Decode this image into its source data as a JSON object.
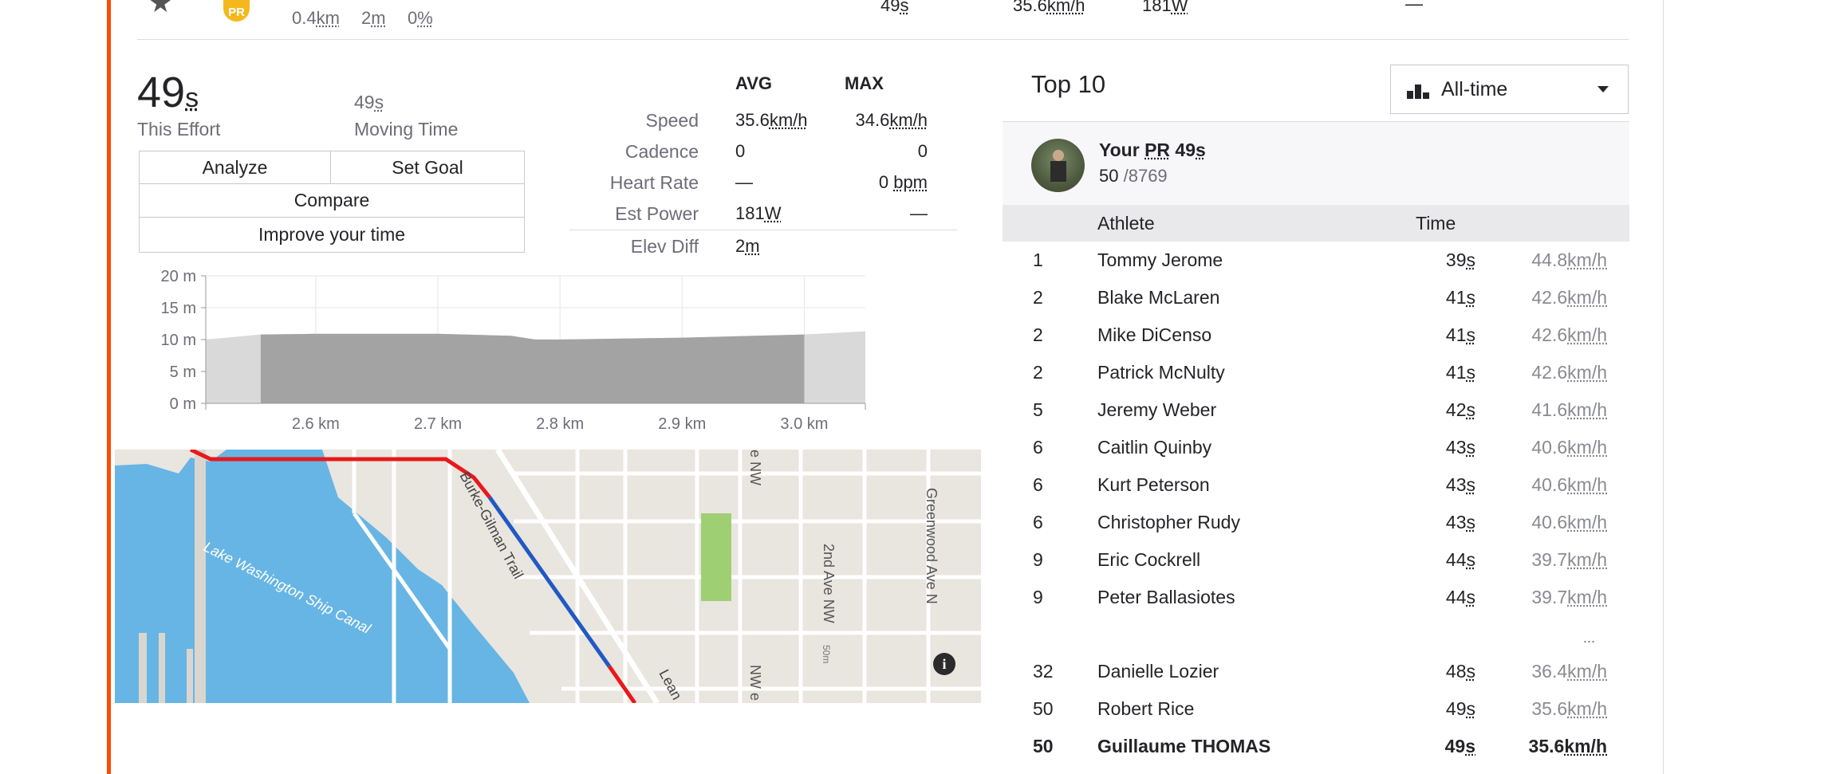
{
  "top_row": {
    "pr_badge": "PR",
    "distance": "0.4",
    "distance_unit": "km",
    "elev": "2",
    "elev_unit": "m",
    "grade": "0",
    "grade_unit": "%",
    "time": "49",
    "time_unit": "s",
    "speed": "35.6",
    "speed_unit": "km/h",
    "power": "181",
    "power_unit": "W",
    "hr": "—"
  },
  "effort": {
    "time": "49",
    "time_unit": "s",
    "label": "This Effort",
    "moving_time": "49",
    "moving_time_unit": "s",
    "moving_label": "Moving Time"
  },
  "buttons": {
    "analyze": "Analyze",
    "set_goal": "Set Goal",
    "compare": "Compare",
    "improve": "Improve your time"
  },
  "stats": {
    "avg_header": "AVG",
    "max_header": "MAX",
    "rows": [
      {
        "label": "Speed",
        "avg": "35.6",
        "avg_unit": "km/h",
        "max": "34.6",
        "max_unit": "km/h"
      },
      {
        "label": "Cadence",
        "avg": "0",
        "avg_unit": "",
        "max": "0",
        "max_unit": ""
      },
      {
        "label": "Heart Rate",
        "avg": "—",
        "avg_unit": "",
        "max": "0",
        "max_unit": "bpm"
      },
      {
        "label": "Est Power",
        "avg": "181",
        "avg_unit": "W",
        "max": "—",
        "max_unit": ""
      }
    ],
    "elev_label": "Elev Diff",
    "elev_value": "2",
    "elev_unit": "m"
  },
  "chart_data": {
    "type": "area",
    "x_ticks": [
      "2.6 km",
      "2.7 km",
      "2.8 km",
      "2.9 km",
      "3.0 km"
    ],
    "y_ticks": [
      "20 m",
      "15 m",
      "10 m",
      "5 m",
      "0 m"
    ],
    "ylim": [
      0,
      20
    ],
    "xlim": [
      2.51,
      3.05
    ],
    "segment_range": [
      2.555,
      3.0
    ],
    "x": [
      2.51,
      2.555,
      2.6,
      2.7,
      2.76,
      2.78,
      2.8,
      2.9,
      3.0,
      3.05
    ],
    "y": [
      10.0,
      10.8,
      10.9,
      10.9,
      10.6,
      10.0,
      10.0,
      10.3,
      10.8,
      11.3
    ]
  },
  "map": {
    "labels": {
      "canal": "Lake Washington Ship Canal",
      "trail": "Burke-Gilman Trail",
      "ave1": "2nd Ave NW",
      "ave2": "Greenwood Ave N",
      "ave3": "e NW",
      "ave4": "NW e",
      "leary": "Lean",
      "small": "50m"
    },
    "colors": {
      "water": "#67b5e4",
      "route": "#e8181b",
      "segment": "#2159c4"
    }
  },
  "leaderboard": {
    "title": "Top 10",
    "filter": "All-time",
    "you": {
      "prefix": "Your",
      "pr": "PR",
      "time": "49",
      "time_unit": "s",
      "rank": "50",
      "total": "/8769"
    },
    "headers": {
      "athlete": "Athlete",
      "time": "Time"
    },
    "rows": [
      {
        "rank": "1",
        "name": "Tommy Jerome",
        "time": "39",
        "speed": "44.8"
      },
      {
        "rank": "2",
        "name": "Blake McLaren",
        "time": "41",
        "speed": "42.6"
      },
      {
        "rank": "2",
        "name": "Mike DiCenso",
        "time": "41",
        "speed": "42.6"
      },
      {
        "rank": "2",
        "name": "Patrick McNulty",
        "time": "41",
        "speed": "42.6"
      },
      {
        "rank": "5",
        "name": "Jeremy Weber",
        "time": "42",
        "speed": "41.6"
      },
      {
        "rank": "6",
        "name": "Caitlin Quinby",
        "time": "43",
        "speed": "40.6"
      },
      {
        "rank": "6",
        "name": "Kurt Peterson",
        "time": "43",
        "speed": "40.6"
      },
      {
        "rank": "6",
        "name": "Christopher Rudy",
        "time": "43",
        "speed": "40.6"
      },
      {
        "rank": "9",
        "name": "Eric Cockrell",
        "time": "44",
        "speed": "39.7"
      },
      {
        "rank": "9",
        "name": "Peter Ballasiotes",
        "time": "44",
        "speed": "39.7"
      }
    ],
    "ellipsis": "...",
    "tail_rows": [
      {
        "rank": "32",
        "name": "Danielle Lozier",
        "time": "48",
        "speed": "36.4"
      },
      {
        "rank": "50",
        "name": "Robert Rice",
        "time": "49",
        "speed": "35.6"
      },
      {
        "rank": "50",
        "name": "Guillaume THOMAS",
        "time": "49",
        "speed": "35.6"
      }
    ],
    "time_unit": "s",
    "speed_unit": "km/h"
  }
}
